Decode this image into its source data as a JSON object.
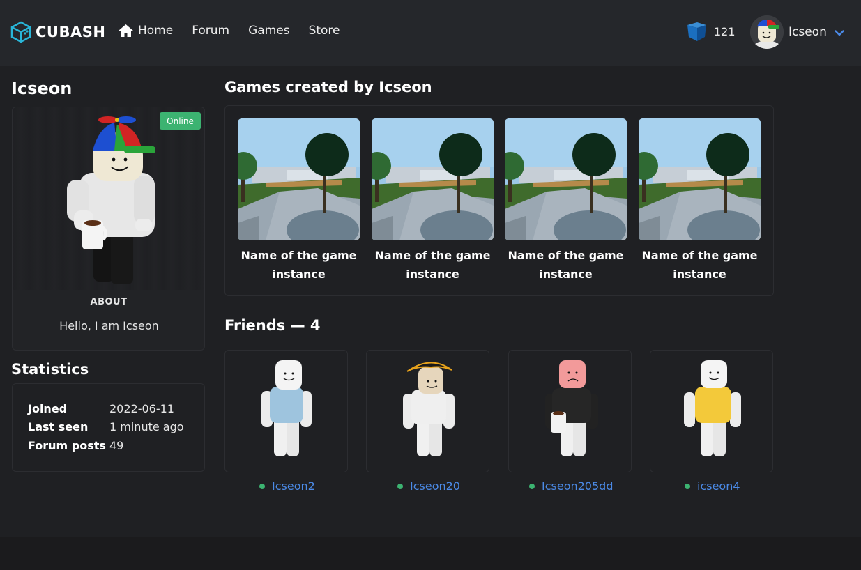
{
  "header": {
    "brand": "CUBASH",
    "nav": [
      {
        "label": "Home",
        "icon": "home-icon"
      },
      {
        "label": "Forum"
      },
      {
        "label": "Games"
      },
      {
        "label": "Store"
      }
    ],
    "currency": {
      "icon": "cube-currency-icon",
      "amount": "121"
    },
    "user": {
      "name": "Icseon",
      "icon": "chevron-down-icon"
    }
  },
  "profile": {
    "name": "Icseon",
    "status": "Online",
    "about_title": "ABOUT",
    "about_text": "Hello, I am Icseon"
  },
  "statistics": {
    "heading": "Statistics",
    "rows": [
      {
        "label": "Joined",
        "value": "2022-06-11"
      },
      {
        "label": "Last seen",
        "value": "1 minute ago"
      },
      {
        "label": "Forum posts",
        "value": "49"
      }
    ]
  },
  "games": {
    "heading_prefix": "Games created by ",
    "heading_user": "Icseon",
    "items": [
      {
        "title": "Name of the game instance"
      },
      {
        "title": "Name of the game instance"
      },
      {
        "title": "Name of the game instance"
      },
      {
        "title": "Name of the game instance"
      }
    ]
  },
  "friends": {
    "heading": "Friends — 4",
    "items": [
      {
        "name": "Icseon2",
        "online": true
      },
      {
        "name": "Icseon20",
        "online": true
      },
      {
        "name": "Icseon205dd",
        "online": true
      },
      {
        "name": "icseon4",
        "online": true
      }
    ]
  },
  "colors": {
    "background": "#1f2023",
    "header": "#25272b",
    "accent": "#29b6d8",
    "online": "#3cb371",
    "link": "#4b8ae6"
  }
}
